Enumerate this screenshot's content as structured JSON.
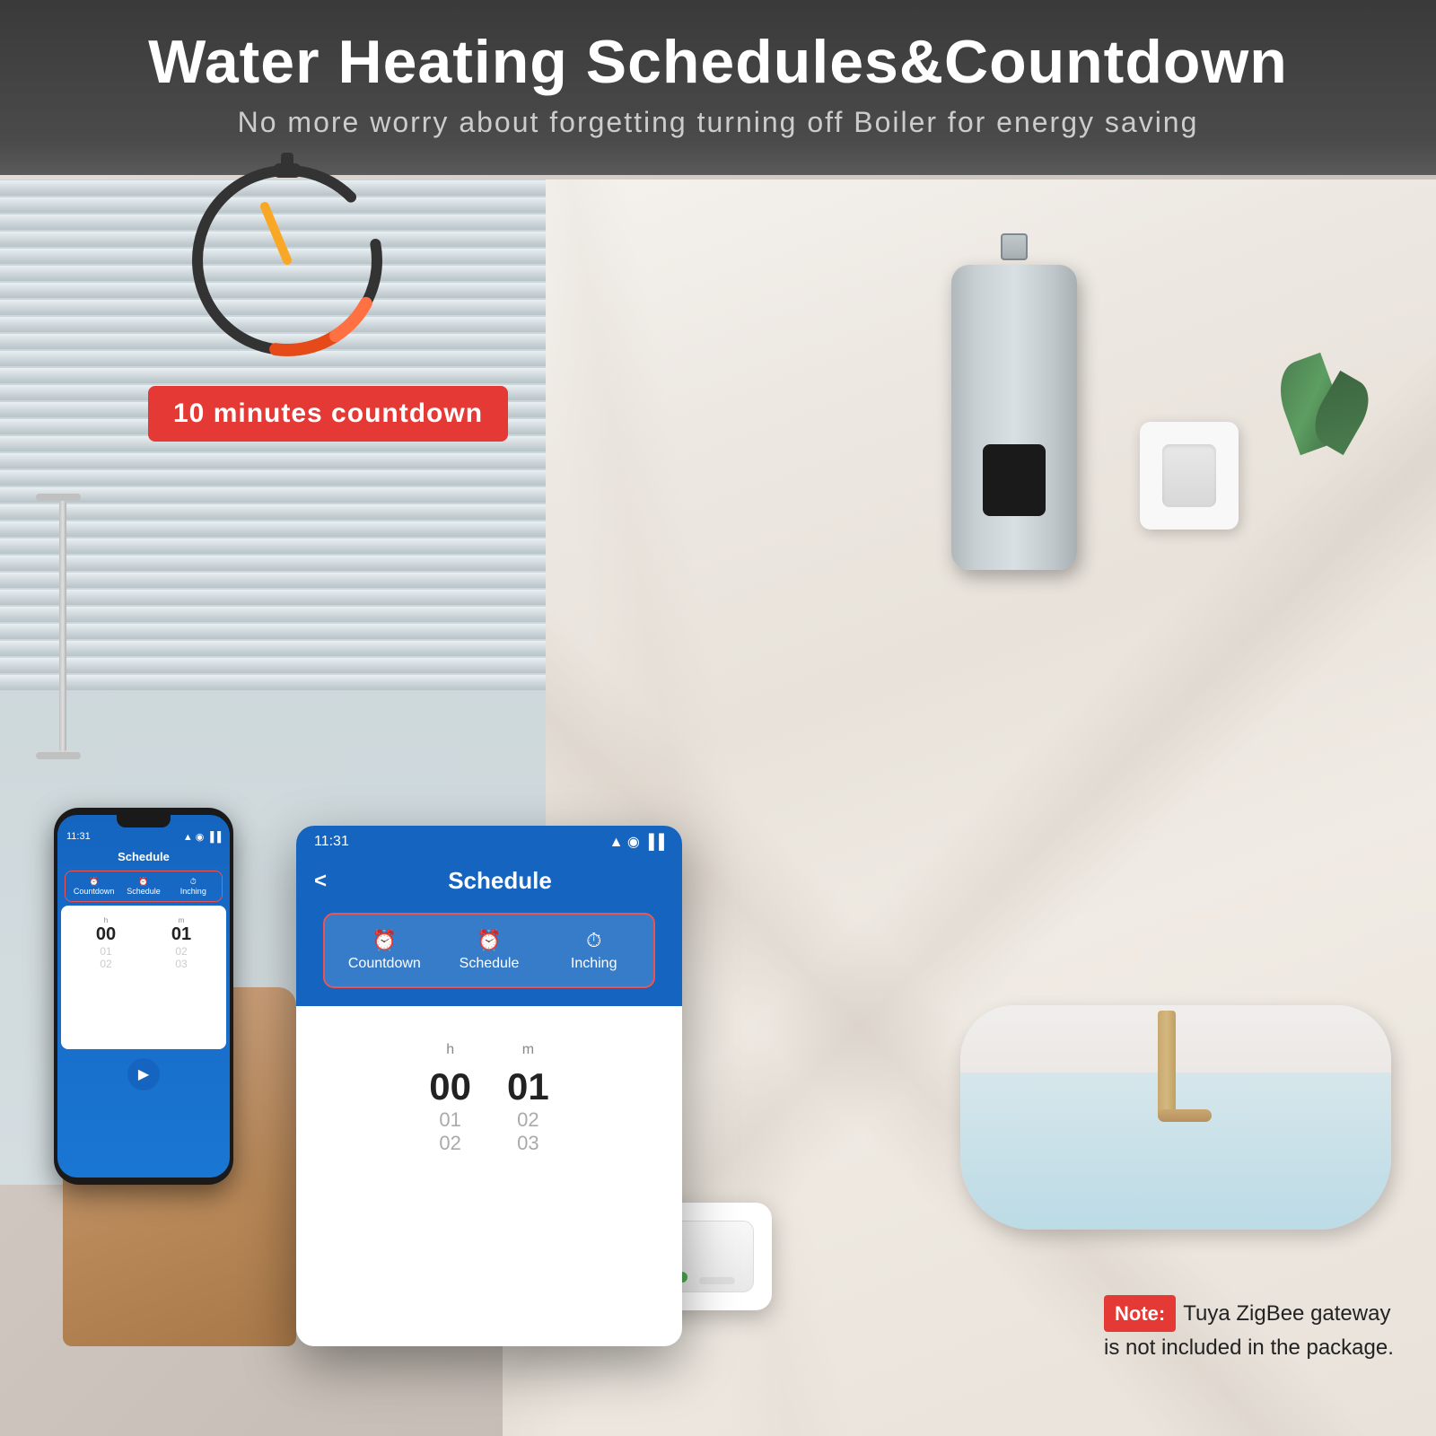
{
  "header": {
    "title": "Water Heating Schedules&Countdown",
    "subtitle": "No more worry about forgetting turning off Boiler for energy saving"
  },
  "countdown_badge": {
    "text": "10 minutes countdown"
  },
  "phone_app": {
    "time": "11:31",
    "signal_icon": "wifi-icon",
    "battery_icon": "battery-icon",
    "title": "Schedule",
    "back_label": "<",
    "tabs": [
      {
        "icon": "⏰",
        "label": "Countdown"
      },
      {
        "icon": "⏰",
        "label": "Schedule"
      },
      {
        "icon": "⏱",
        "label": "Inching"
      }
    ],
    "time_picker": {
      "hours_label": "h",
      "minutes_label": "m",
      "hours_value": "00",
      "minutes_value": "01",
      "hours_sub1": "01",
      "hours_sub2": "02",
      "minutes_sub1": "02",
      "minutes_sub2": "03"
    }
  },
  "note": {
    "label": "Note:",
    "text": "Tuya ZigBee gateway is not included in the package."
  }
}
